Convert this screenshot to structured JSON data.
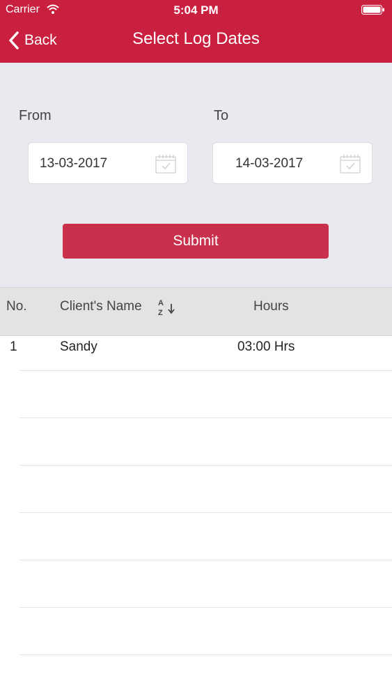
{
  "status_bar": {
    "carrier": "Carrier",
    "time": "5:04 PM"
  },
  "nav": {
    "back_label": "Back",
    "title": "Select Log Dates"
  },
  "filter": {
    "from_label": "From",
    "to_label": "To",
    "from_date": "13-03-2017",
    "to_date": "14-03-2017",
    "submit_label": "Submit"
  },
  "table": {
    "headers": {
      "no": "No.",
      "client_name": "Client's Name",
      "hours": "Hours"
    },
    "rows": [
      {
        "no": "1",
        "client_name": "Sandy",
        "hours": "03:00 Hrs"
      }
    ]
  },
  "colors": {
    "brand": "#c9203f",
    "button": "#c9304c",
    "filter_bg": "#e9e9f0",
    "header_bg": "#e3e3e3"
  }
}
